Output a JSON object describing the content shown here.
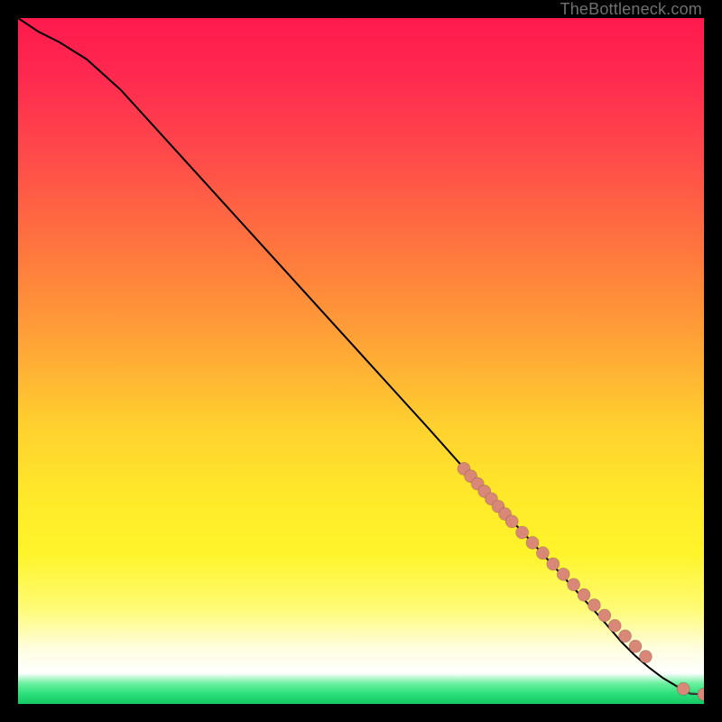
{
  "watermark": {
    "text": "TheBottleneck.com"
  },
  "chart_data": {
    "type": "line",
    "title": "",
    "xlabel": "",
    "ylabel": "",
    "xlim": [
      0,
      100
    ],
    "ylim": [
      0,
      100
    ],
    "grid": false,
    "legend_position": "none",
    "background_gradient": {
      "top_hex": "#ff1a4d",
      "mid_hex": "#ffe92a",
      "bottom_hex": "#14c862"
    },
    "series": [
      {
        "name": "curve",
        "x": [
          0,
          3,
          6,
          10,
          15,
          20,
          30,
          40,
          50,
          60,
          68,
          75,
          80,
          85,
          88,
          90,
          92,
          94,
          96,
          98,
          100
        ],
        "y": [
          100,
          98,
          96.5,
          94,
          89.5,
          84,
          73,
          62,
          51,
          40,
          31,
          23.5,
          18,
          12.5,
          9,
          7,
          5.3,
          3.8,
          2.6,
          1.5,
          1.4
        ]
      },
      {
        "name": "points",
        "x": [
          65,
          66,
          67,
          68,
          69,
          70,
          71,
          72,
          73.5,
          75,
          76.5,
          78,
          79.5,
          81,
          82.5,
          84,
          85.5,
          87,
          88.5,
          90,
          91.5,
          97,
          100
        ],
        "y": [
          34.3,
          33.2,
          32.1,
          31.0,
          29.9,
          28.8,
          27.7,
          26.6,
          25.0,
          23.5,
          22.0,
          20.4,
          18.9,
          17.4,
          15.9,
          14.4,
          12.9,
          11.4,
          9.9,
          8.4,
          6.9,
          2.2,
          1.4
        ]
      }
    ]
  }
}
